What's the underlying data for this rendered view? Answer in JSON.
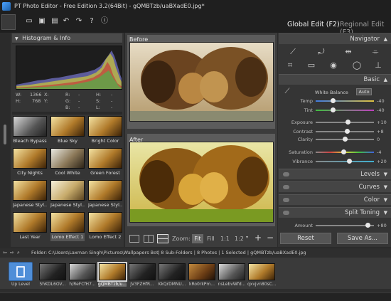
{
  "window": {
    "title": "PT Photo Editor - Free Edition 3.2(64Bit) - gQMBTzb/uaBXadE0.jpg*"
  },
  "tabs": {
    "global": "Global Edit (F2)",
    "regional": "Regional Edit (F3)"
  },
  "histogram": {
    "title": "Histogram & Info",
    "w_label": "W:",
    "w_value": "1366",
    "h_label": "H:",
    "h_value": "768",
    "x_label": "X:",
    "y_label": "Y:",
    "r_label": "R:",
    "g_label": "G:",
    "b_label": "B:",
    "hh_label": "H:",
    "s_label": "S:",
    "l_label": "L:",
    "dash": "-"
  },
  "effects": [
    {
      "label": "Bleach Bypass",
      "tone": "bw"
    },
    {
      "label": "Blue Sky",
      "tone": "warm"
    },
    {
      "label": "Bright Color",
      "tone": "warm"
    },
    {
      "label": "City Nights",
      "tone": "warm"
    },
    {
      "label": "Cool White",
      "tone": "cool"
    },
    {
      "label": "Green Forest",
      "tone": "warm"
    },
    {
      "label": "Japanese Styl...",
      "tone": "warm"
    },
    {
      "label": "Japanese Styl...",
      "tone": "pale"
    },
    {
      "label": "Japanese Styl...",
      "tone": "warm"
    },
    {
      "label": "Last Year",
      "tone": "warm"
    },
    {
      "label": "Lomo Effect 1",
      "tone": "warm",
      "selected": true
    },
    {
      "label": "Lomo Effect 2",
      "tone": "warm"
    }
  ],
  "preview": {
    "before": "Before",
    "after": "After"
  },
  "zoom": {
    "label": "Zoom:",
    "fit": "Fit",
    "fill": "Fill",
    "one": "1:1",
    "half": "1:2",
    "plus": "+",
    "minus": "−"
  },
  "navigator": {
    "title": "Navigator"
  },
  "basic": {
    "title": "Basic",
    "white_balance": "White Balance",
    "auto": "Auto",
    "sliders": [
      {
        "name": "Temp",
        "value": "-40",
        "pos": 0.3
      },
      {
        "name": "Tint",
        "value": "-40",
        "pos": 0.3
      },
      {
        "name": "Exposure",
        "value": "+10",
        "pos": 0.55
      },
      {
        "name": "Contrast",
        "value": "+8",
        "pos": 0.54
      },
      {
        "name": "Clarity",
        "value": "0",
        "pos": 0.5
      },
      {
        "name": "Saturation",
        "value": "-4",
        "pos": 0.48
      },
      {
        "name": "Vibrance",
        "value": "+20",
        "pos": 0.58
      }
    ]
  },
  "sections": {
    "levels": "Levels",
    "curves": "Curves",
    "color": "Color",
    "split_toning": "Split Toning"
  },
  "amount": {
    "label": "Amount",
    "value": "+80",
    "pos": 0.9
  },
  "buttons": {
    "reset": "Reset",
    "save_as": "Save As..."
  },
  "folder": {
    "label": "Folder:",
    "path": "C:\\Users\\Laxman Singh\\Pictures\\Wallpapers Bot",
    "summary": "| 8 Sub-Folders | 8 Photos | 1 Selected | gQMBTzb/uaBXadE0.jpg"
  },
  "filmstrip": {
    "up_level": "Up Level",
    "items": [
      {
        "label": "5hKDL6OV...",
        "tone": "dark"
      },
      {
        "label": "h/ReFCfH7...",
        "tone": "bw"
      },
      {
        "label": "gQMBTzb/u...",
        "tone": "warm",
        "selected": true
      },
      {
        "label": "jV3FZHfR...",
        "tone": "dark"
      },
      {
        "label": "KkQrDMNU...",
        "tone": "dark"
      },
      {
        "label": "kRo0rkPm...",
        "tone": "brown"
      },
      {
        "label": "nsLebvWfd...",
        "tone": "bw"
      },
      {
        "label": "qxvjvn80sC...",
        "tone": "warm"
      }
    ]
  }
}
